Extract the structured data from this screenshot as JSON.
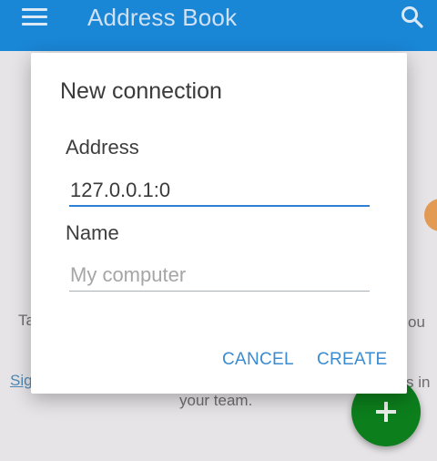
{
  "appbar": {
    "title": "Address Book",
    "menu_icon": "hamburger-menu-icon",
    "search_icon": "search-icon",
    "color": "#1a86d6"
  },
  "background": {
    "left_fragment_1": "Ta",
    "right_fragment_1": "ou",
    "link_fragment": "Sig",
    "right_fragment_2": "s in",
    "team_text": "your team."
  },
  "fab": {
    "icon": "plus-icon",
    "color": "#0c7e1c"
  },
  "dialog": {
    "title": "New connection",
    "address": {
      "label": "Address",
      "value": "127.0.0.1:0"
    },
    "name": {
      "label": "Name",
      "placeholder": "My computer"
    },
    "buttons": {
      "cancel": "CANCEL",
      "create": "CREATE"
    },
    "accent_color": "#3b8bd0"
  }
}
